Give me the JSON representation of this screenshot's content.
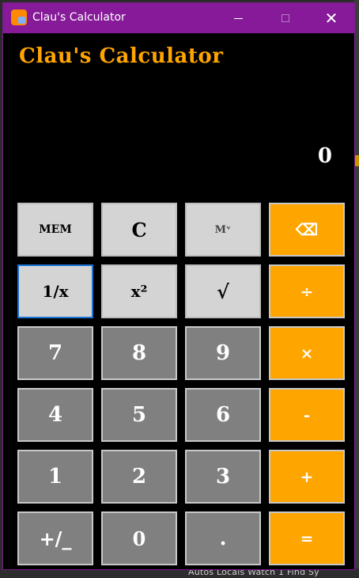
{
  "window": {
    "title": "Clau's Calculator",
    "controls": {
      "minimize": "—",
      "maximize": "☐",
      "close": "✕"
    }
  },
  "app": {
    "heading": "Clau's Calculator",
    "display_value": "0"
  },
  "keypad": {
    "mem": "MEM",
    "clear": "C",
    "mem_list": "Mᵛ",
    "backspace": "⌫",
    "reciprocal": "1/x",
    "square": "x²",
    "sqrt": "√",
    "divide": "÷",
    "seven": "7",
    "eight": "8",
    "nine": "9",
    "multiply": "×",
    "four": "4",
    "five": "5",
    "six": "6",
    "minus": "-",
    "one": "1",
    "two": "2",
    "three": "3",
    "plus": "+",
    "negate": "+/_",
    "zero": "0",
    "decimal": ".",
    "equals": "="
  },
  "background": {
    "bottom_text": "Autos   Locals   Watch 1   Find Sy"
  },
  "colors": {
    "titlebar": "#861a99",
    "accent": "#ffa500",
    "digit_button": "#808080",
    "function_button": "#d4d4d4",
    "window_background": "#000000"
  }
}
